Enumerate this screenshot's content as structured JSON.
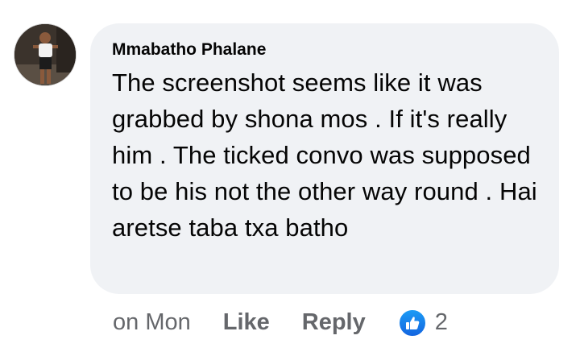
{
  "comment": {
    "author": "Mmabatho Phalane",
    "text": "The screenshot seems like it was grabbed by shona mos . If it's really him . The ticked convo was supposed to be his not the other way round . Hai aretse taba txa batho",
    "timestamp": "on Mon",
    "like_label": "Like",
    "reply_label": "Reply",
    "reaction_count": "2",
    "reaction_icon": "thumbs-up-icon"
  },
  "colors": {
    "bubble": "#f0f2f5",
    "text": "#050505",
    "meta": "#65676b",
    "like_blue": "#1877f2"
  }
}
